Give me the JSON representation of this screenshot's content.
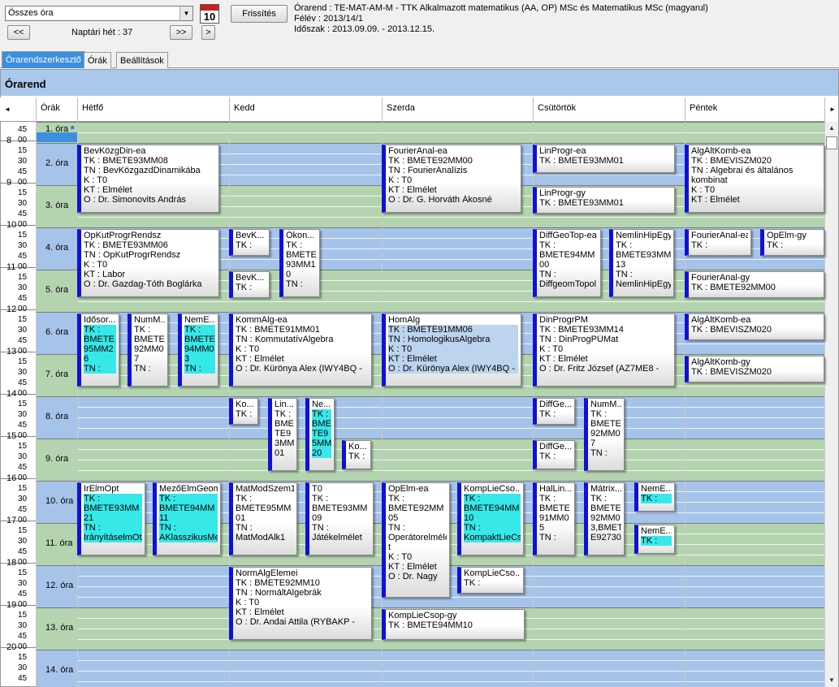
{
  "toolbar": {
    "combo_value": "Összes óra",
    "refresh_label": "Frissítés",
    "prev_label": "<<",
    "next_label": ">>",
    "next2_label": ">",
    "week_label": "Naptári hét : 37",
    "calendar_num": "10"
  },
  "info": {
    "line1": "Órarend : TE-MAT-AM-M - TTK Alkalmazott matematikus (AA, OP) MSc és Matematikus MSc (magyarul)",
    "line2": "Félév : 2013/14/1",
    "line3": "Időszak : 2013.09.09. - 2013.12.15."
  },
  "tabs": [
    {
      "label": "Órarendszerkesztő"
    },
    {
      "label": "Órák"
    },
    {
      "label": "Beállítások"
    }
  ],
  "panel_title": "Órarend",
  "columns": {
    "left_arrow": "◄",
    "right_arrow": "►",
    "orak": "Órák",
    "mon": "Hétfő",
    "tue": "Kedd",
    "wed": "Szerda",
    "thu": "Csütörtök",
    "fri": "Péntek"
  },
  "slots": [
    {
      "label": "1. óra"
    },
    {
      "label": "2. óra"
    },
    {
      "label": "3. óra"
    },
    {
      "label": "4. óra"
    },
    {
      "label": "5. óra"
    },
    {
      "label": "6. óra"
    },
    {
      "label": "7. óra"
    },
    {
      "label": "8. óra"
    },
    {
      "label": "9. óra"
    },
    {
      "label": "10. óra"
    },
    {
      "label": "11. óra"
    },
    {
      "label": "12. óra"
    },
    {
      "label": "13. óra"
    },
    {
      "label": "14. óra"
    }
  ],
  "hours": [
    "8",
    "9",
    "10",
    "11",
    "12",
    "13",
    "14",
    "15",
    "16",
    "17",
    "18",
    "19",
    "20"
  ],
  "events": [
    {
      "lines": [
        "BevKözgDin-ea",
        "TK : BMETE93MM08",
        "TN : BevKözgazdDinamikába",
        "K : T0",
        "KT : Elmélet",
        "O :  Dr. Simonovits András"
      ]
    },
    {
      "lines": [
        "FourierAnal-ea",
        "TK : BMETE92MM00",
        "TN : FourierAnalízis",
        "K : T0",
        "KT : Elmélet",
        "O :  Dr. G. Horváth Ákosné"
      ]
    },
    {
      "lines": [
        "LinProgr-ea",
        "TK : BMETE93MM01"
      ]
    },
    {
      "lines": [
        "AlgÁltKomb-ea",
        "TK : BMEVISZM020",
        "TN : Algebrai és általános",
        "kombinat",
        "K : T0",
        "KT : Elmélet"
      ]
    },
    {
      "lines": [
        "LinProgr-gy",
        "TK : BMETE93MM01"
      ]
    },
    {
      "lines": [
        "OpKutProgrRendsz",
        "TK : BMETE93MM06",
        "TN : OpKutProgrRendsz",
        "K : T0",
        "KT : Labor",
        "O :  Dr. Gazdag-Tóth Boglárka"
      ]
    },
    {
      "lines": [
        "BevK...",
        "TK :"
      ]
    },
    {
      "lines": [
        "Ökon...",
        "TK :",
        "BMETE",
        "93MM1",
        "0",
        "TN :"
      ]
    },
    {
      "lines": [
        "DiffGeoTop-ea",
        "TK :",
        "BMETE94MM",
        "00",
        "TN :",
        "DiffgeomTopol"
      ]
    },
    {
      "lines": [
        "NemlinHipEgy",
        "TK :",
        "BMETE93MM",
        "13",
        "TN :",
        "NemlinHipEgy"
      ]
    },
    {
      "lines": [
        "FourierAnal-ea",
        "TK :"
      ]
    },
    {
      "lines": [
        "OpElm-gy",
        "TK :"
      ]
    },
    {
      "lines": [
        "BevK...",
        "TK :"
      ]
    },
    {
      "lines": [
        "FourierAnal-gy",
        "TK : BMETE92MM00"
      ]
    },
    {
      "lines": [
        "Idősor...",
        "TK :",
        "BMETE",
        "95MM2",
        "6",
        "TN :"
      ]
    },
    {
      "lines": [
        "NumM...",
        "TK :",
        "BMETE",
        "92MM0",
        "7",
        "TN :"
      ]
    },
    {
      "lines": [
        "NemE...",
        "TK :",
        "BMETE",
        "94MM0",
        "3",
        "TN :"
      ]
    },
    {
      "lines": [
        "KommAlg-ea",
        "TK : BMETE91MM01",
        "TN : KommutatívAlgebra",
        "K : T0",
        "KT : Elmélet",
        "O :  Dr. Kürönya Alex (IWY4BQ -"
      ]
    },
    {
      "lines": [
        "HomAlg",
        "TK : BMETE91MM06",
        "TN : HomologikusAlgebra",
        "K : T0",
        "KT : Elmélet",
        "O :  Dr. Kürönya Alex (IWY4BQ -"
      ]
    },
    {
      "lines": [
        "DinProgrPM",
        "TK : BMETE93MM14",
        "TN : DinProgPÜMat",
        "K : T0",
        "KT : Elmélet",
        "O :  Dr. Fritz József (AZ7ME8 -"
      ]
    },
    {
      "lines": [
        "AlgÁltKomb-ea",
        "TK : BMEVISZM020"
      ]
    },
    {
      "lines": [
        "AlgÁltKomb-gy",
        "TK : BMEVISZM020"
      ]
    },
    {
      "lines": [
        "Ko...",
        "TK :"
      ]
    },
    {
      "lines": [
        "Lin...",
        "TK :",
        "BME",
        "TE9",
        "3MM",
        "01"
      ]
    },
    {
      "lines": [
        "Ne...",
        "TK :",
        "BME",
        "TE9",
        "5MM",
        "20"
      ]
    },
    {
      "lines": [
        "DiffGe...",
        "TK :"
      ]
    },
    {
      "lines": [
        "NumM...",
        "TK :",
        "BMETE",
        "92MM0",
        "7",
        "TN :"
      ]
    },
    {
      "lines": [
        "Ko...",
        "TK :"
      ]
    },
    {
      "lines": [
        "DiffGe...",
        "TK :"
      ]
    },
    {
      "lines": [
        "IrElmOpt",
        "TK :",
        "BMETE93MM",
        "21",
        "TN :",
        "IrányításelmOti"
      ]
    },
    {
      "lines": [
        "MezőElmGeom",
        "TK :",
        "BMETE94MM",
        "11",
        "TN :",
        "AKlasszikusMe"
      ]
    },
    {
      "lines": [
        "MatModSzem1",
        "TK :",
        "BMETE95MM",
        "01",
        "TN :",
        "MatModAlk1"
      ]
    },
    {
      "lines": [
        "T0",
        "TK :",
        "BMETE93MM",
        "09",
        "TN :",
        "Játékelmélet"
      ]
    },
    {
      "lines": [
        "OpElm-ea",
        "TK :",
        "BMETE92MM",
        "05",
        "TN :",
        "Operátorelmélet",
        "t",
        "K : T0",
        "KT : Elmélet",
        "O :  Dr. Nagy"
      ]
    },
    {
      "lines": [
        "KompLieCso...",
        "TK :",
        "BMETE94MM",
        "10",
        "TN :",
        "KompaktLieCs"
      ]
    },
    {
      "lines": [
        "HalLin...",
        "TK :",
        "BMETE",
        "91MM0",
        "5",
        "TN :"
      ]
    },
    {
      "lines": [
        "Mátrix...",
        "TK :",
        "BMETE",
        "92MM0",
        "3,BMET",
        "E92730"
      ]
    },
    {
      "lines": [
        "NemE...",
        "TK :"
      ]
    },
    {
      "lines": [
        "NemE...",
        "TK :"
      ]
    },
    {
      "lines": [
        "NormAlgElemei",
        "TK : BMETE92MM10",
        "TN : NormáltAlgebrák",
        "K : T0",
        "KT : Elmélet",
        "O :  Dr. Andai Attila (RYBAKP -"
      ]
    },
    {
      "lines": [
        "KompLieCso...",
        "TK :"
      ]
    },
    {
      "lines": [
        "KompLieCsop-gy",
        "TK : BMETE94MM10"
      ]
    }
  ]
}
